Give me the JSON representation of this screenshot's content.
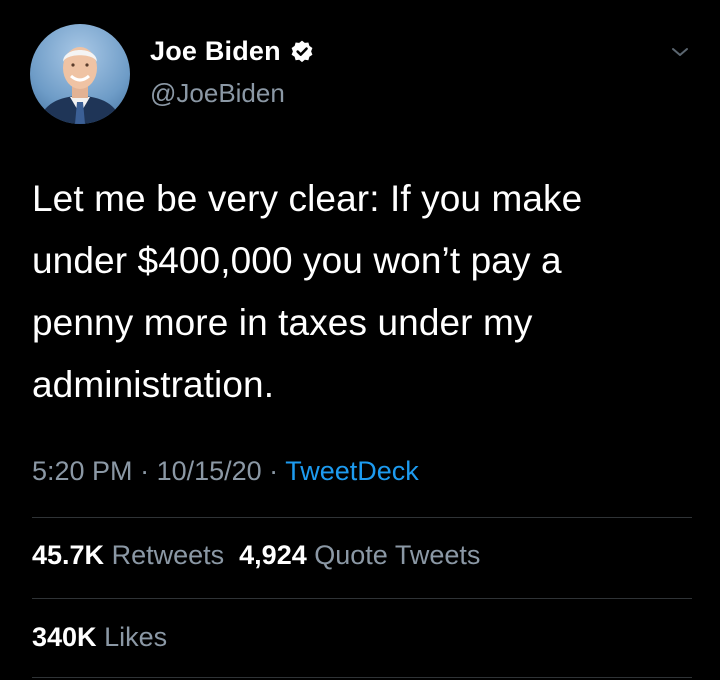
{
  "author": {
    "display_name": "Joe Biden",
    "handle": "@JoeBiden",
    "avatar_icon": "profile-photo",
    "verified_icon": "verified-badge-icon",
    "menu_icon": "chevron-down-icon"
  },
  "tweet": {
    "text": "Let me be very clear: If you make\nunder $400,000 you won’t pay a\npenny more in taxes under my\nadministration."
  },
  "meta": {
    "time": "5:20 PM",
    "separator1": " · ",
    "date": "10/15/20",
    "separator2": " · ",
    "source": "TweetDeck"
  },
  "stats": {
    "retweets_count": "45.7K",
    "retweets_label": "Retweets",
    "quote_count": "4,924",
    "quote_label": "Quote Tweets",
    "likes_count": "340K",
    "likes_label": "Likes"
  },
  "colors": {
    "background": "#000000",
    "text_primary": "#ffffff",
    "text_secondary": "#8b98a5",
    "link": "#1d9bf0",
    "divider": "#2f3336"
  }
}
